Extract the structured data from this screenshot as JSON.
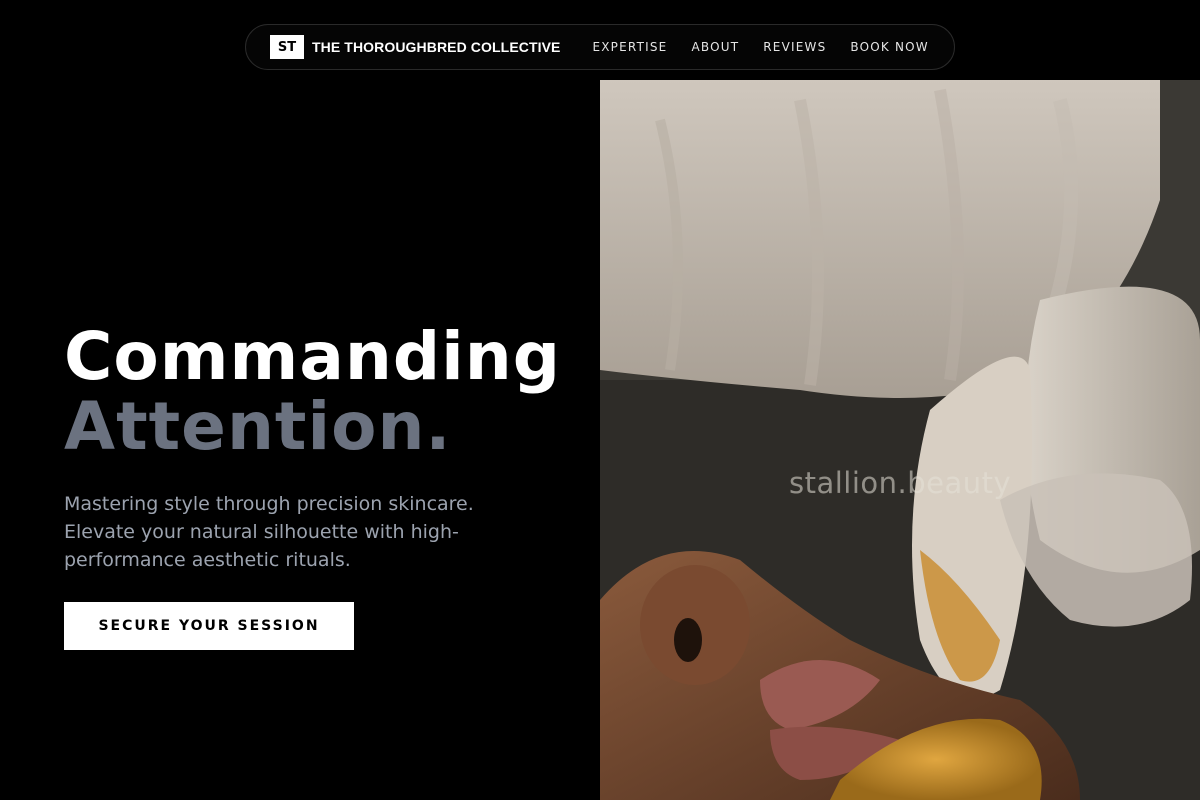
{
  "brand": {
    "mark": "ST",
    "name": "THE THOROUGHBRED COLLECTIVE"
  },
  "nav": {
    "links": [
      "EXPERTISE",
      "ABOUT",
      "REVIEWS",
      "BOOK NOW"
    ]
  },
  "hero": {
    "headline_line1": "Commanding",
    "headline_line2": "Attention.",
    "tagline": "Mastering style through precision skincare. Elevate your natural silhouette with high-performance aesthetic rituals.",
    "cta_label": "SECURE YOUR SESSION",
    "image": {
      "watermark": "stallion.beauty"
    }
  },
  "colors": {
    "background": "#000000",
    "headline_primary": "#ffffff",
    "headline_secondary": "#6b7280",
    "tagline": "#9ca3af",
    "cta_background": "#ffffff",
    "cta_text": "#000000"
  }
}
